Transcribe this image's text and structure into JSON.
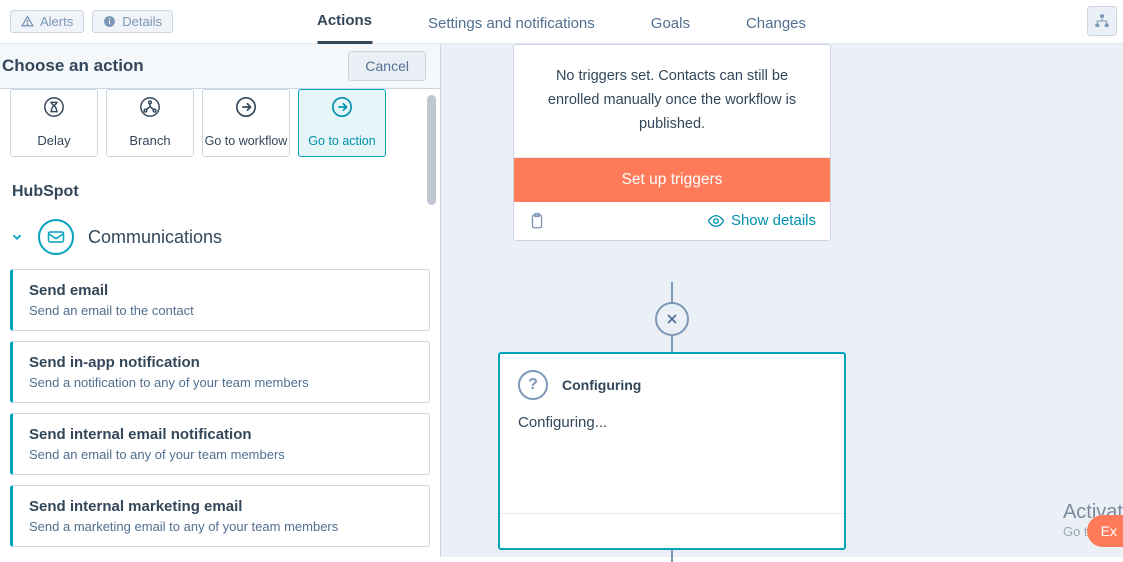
{
  "topbar": {
    "alerts": "Alerts",
    "details": "Details"
  },
  "tabs": [
    "Actions",
    "Settings and notifications",
    "Goals",
    "Changes"
  ],
  "activeTab": 0,
  "sidebar": {
    "title": "Choose an action",
    "cancel": "Cancel",
    "cards": [
      "Delay",
      "Branch",
      "Go to workflow",
      "Go to action"
    ],
    "section": "HubSpot",
    "group": "Communications",
    "options": [
      {
        "t": "Send email",
        "d": "Send an email to the contact"
      },
      {
        "t": "Send in-app notification",
        "d": "Send a notification to any of your team members"
      },
      {
        "t": "Send internal email notification",
        "d": "Send an email to any of your team members"
      },
      {
        "t": "Send internal marketing email",
        "d": "Send a marketing email to any of your team members"
      }
    ]
  },
  "canvas": {
    "triggerText": "No triggers set. Contacts can still be enrolled manually once the workflow is published.",
    "setup": "Set up triggers",
    "showDetails": "Show details",
    "cfgTitle": "Configuring",
    "cfgBody": "Configuring..."
  },
  "watermark": {
    "l1": "Activat",
    "l2": "Go to"
  },
  "ex": "Ex"
}
